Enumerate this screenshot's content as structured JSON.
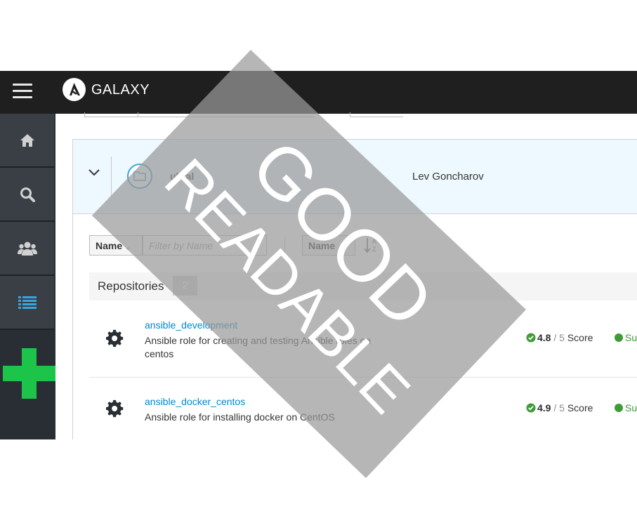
{
  "header": {
    "brand": "GALAXY"
  },
  "sidebar": {
    "items": [
      "home-icon",
      "search-icon",
      "users-icon",
      "list-icon",
      "add-icon"
    ]
  },
  "collection": {
    "name": "ultral",
    "author": "Lev Goncharov"
  },
  "toolbar": {
    "filter_type": "Name",
    "filter_placeholder": "Filter by Name",
    "sort_by": "Name",
    "sort_icon": "sort-alpha-asc-icon"
  },
  "repositories": {
    "label": "Repositories",
    "count": "2",
    "items": [
      {
        "name": "ansible_development",
        "description": "Ansible role for creating and testing Ansible roles on centos",
        "score_value": "4.8",
        "score_max": "/ 5",
        "score_label": "Score",
        "status": "Su"
      },
      {
        "name": "ansible_docker_centos",
        "description": "Ansible role for installing docker on CentOS",
        "score_value": "4.9",
        "score_max": "/ 5",
        "score_label": "Score",
        "status": "Su"
      }
    ]
  },
  "watermark": {
    "line1": "GOOD",
    "line2": "READABLE"
  },
  "colors": {
    "topbar": "#1f1f1f",
    "sidebar": "#292e34",
    "link": "#0088ce",
    "success": "#3f9c35",
    "accent_green": "#1cc44a"
  }
}
